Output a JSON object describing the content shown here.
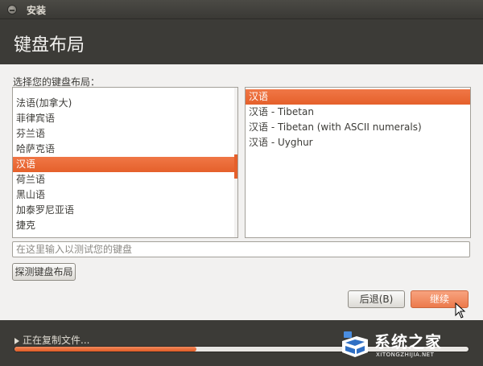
{
  "window": {
    "title": "安装"
  },
  "header": {
    "title": "键盘布局"
  },
  "layout_prompt": "选择您的键盘布局：",
  "left_list": {
    "items": [
      {
        "label": "法语(加拿大)",
        "selected": false
      },
      {
        "label": "菲律宾语",
        "selected": false
      },
      {
        "label": "芬兰语",
        "selected": false
      },
      {
        "label": "哈萨克语",
        "selected": false
      },
      {
        "label": "汉语",
        "selected": true
      },
      {
        "label": "荷兰语",
        "selected": false
      },
      {
        "label": "黑山语",
        "selected": false
      },
      {
        "label": "加泰罗尼亚语",
        "selected": false
      },
      {
        "label": "捷克",
        "selected": false
      }
    ]
  },
  "right_list": {
    "items": [
      {
        "label": "汉语",
        "selected": true
      },
      {
        "label": "汉语 - Tibetan",
        "selected": false
      },
      {
        "label": "汉语 - Tibetan (with ASCII numerals)",
        "selected": false
      },
      {
        "label": "汉语 - Uyghur",
        "selected": false
      }
    ]
  },
  "test_input": {
    "placeholder": "在这里输入以测试您的键盘",
    "value": ""
  },
  "buttons": {
    "detect": "探测键盘布局",
    "back": "后退(B)",
    "continue": "继续"
  },
  "footer": {
    "status": "正在复制文件...",
    "progress": 0.4
  },
  "watermark": {
    "text": "系统之家",
    "url": "XITONGZHIJIA.NET"
  },
  "colors": {
    "accent": "#e5602b",
    "dark_bg": "#3c3b37",
    "panel_bg": "#f2f1f0"
  }
}
